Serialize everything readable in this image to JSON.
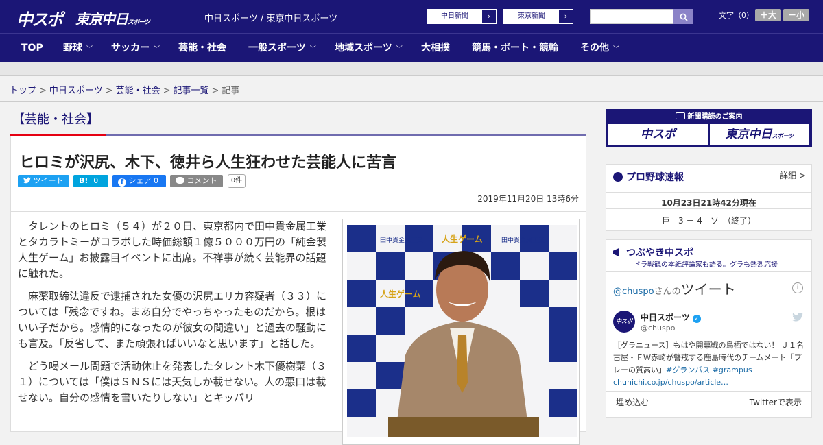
{
  "header": {
    "logo_main": "中スポ",
    "logo_sub": "東京中日",
    "logo_sub_small": "スポーツ",
    "site_name": "中日スポーツ / 東京中日スポーツ",
    "ext_links": [
      {
        "label": "中日新聞",
        "arrow": "›"
      },
      {
        "label": "東京新聞",
        "arrow": "›"
      }
    ],
    "search_placeholder": "",
    "search_icon": "search-icon",
    "font_size_label": "文字（0）",
    "font_bigger": "＋大",
    "font_smaller": "－小"
  },
  "nav": {
    "items": [
      {
        "label": "TOP",
        "chevron": false
      },
      {
        "label": "野球",
        "chevron": true
      },
      {
        "label": "サッカー",
        "chevron": true
      },
      {
        "label": "芸能・社会",
        "chevron": false
      },
      {
        "label": "一般スポーツ",
        "chevron": true
      },
      {
        "label": "地域スポーツ",
        "chevron": true
      },
      {
        "label": "大相撲",
        "chevron": false
      },
      {
        "label": "競馬・ボート・競輪",
        "chevron": false
      },
      {
        "label": "その他",
        "chevron": true
      }
    ]
  },
  "breadcrumb": {
    "items": [
      "トップ",
      "中日スポーツ",
      "芸能・社会",
      "記事一覧"
    ],
    "current": "記事",
    "sep": ">"
  },
  "category": "【芸能・社会】",
  "article": {
    "headline": "ヒロミが沢尻、木下、徳井ら人生狂わせた芸能人に苦言",
    "share": {
      "twitter": "ツイート",
      "hatena": "B!",
      "hatena_count": "0",
      "facebook": "シェア",
      "facebook_count": "0",
      "comment": "コメント",
      "comment_count": "0件"
    },
    "date": "2019年11月20日 13時6分",
    "paragraphs": [
      "タレントのヒロミ（５４）が２０日、東京都内で田中貴金属工業とタカラトミーがコラボした時価総額１億５０００万円の「純金製人生ゲーム」お披露目イベントに出席。不祥事が続く芸能界の話題に触れた。",
      "麻薬取締法違反で逮捕された女優の沢尻エリカ容疑者（３３）については「残念ですね。まあ自分でやっちゃったものだから。根はいい子だから。感情的になったのが彼女の間違い」と過去の騒動にも言及。「反省して、また頑張ればいいなと思います」と話した。",
      "どう喝メール問題で活動休止を発表したタレント木下優樹菜（３１）については「僕はＳＮＳには天気しか載せない。人の悪口は載せない。自分の感情を書いたりしない」とキッパリ"
    ],
    "photo_backdrop": [
      "田中貴金属工業",
      "人生ゲーム"
    ]
  },
  "sidebar": {
    "subscribe": {
      "title": "新聞購読のご案内",
      "btn1": "中スポ",
      "btn2": "東京中日",
      "btn2_small": "スポーツ"
    },
    "baseball": {
      "title": "プロ野球速報",
      "detail": "詳細 >",
      "time": "10月23日21時42分現在",
      "score": "巨　3 － 4　ソ　（終了）"
    },
    "tweets": {
      "title": "つぶやき中スポ",
      "subtitle": "ドラ戦観の本紙評論家も語る。グラも熱烈応援",
      "handle_link": "@chuspo",
      "handle_suffix": "さんの",
      "heading": "ツイート",
      "user_name": "中日スポーツ",
      "user_handle": "@chuspo",
      "avatar_text": "中スポ",
      "text": "［グラニュース］もはや開幕戦の鳥栖ではない！ Ｊ１名古屋・ＦＷ赤崎が警戒する鹿島時代のチームメート「プレーの質高い」",
      "tags": "#グランパス #grampus",
      "url": "chunichi.co.jp/chuspo/article…",
      "embed": "埋め込む",
      "view": "Twitterで表示"
    }
  },
  "colors": {
    "navy": "#1b1676",
    "red": "#e50012",
    "twitter": "#1da1f2",
    "hatena": "#00a4de",
    "facebook": "#1877f2",
    "comment": "#888888"
  }
}
